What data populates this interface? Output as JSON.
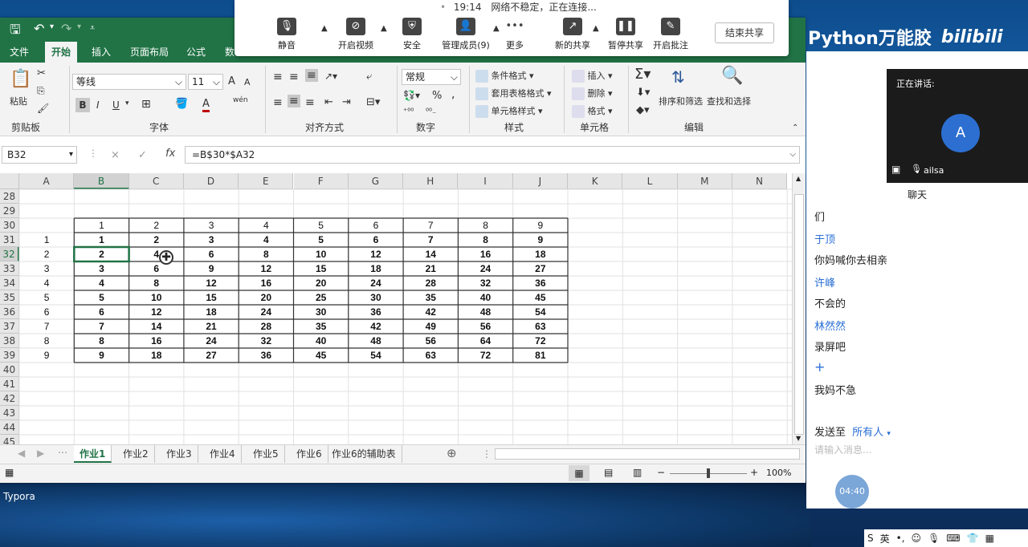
{
  "desktop": {
    "brand_text": "Python万能胶",
    "brand_logo": "bilibili",
    "typora_label": "Typora"
  },
  "excel": {
    "toolbar": {
      "save_icon": "save-icon",
      "undo_icon": "undo-icon",
      "redo_icon": "redo-icon"
    },
    "tabs": [
      "文件",
      "开始",
      "插入",
      "页面布局",
      "公式",
      "数"
    ],
    "active_tab": "开始",
    "ribbon": {
      "clipboard": {
        "paste": "粘贴",
        "label": "剪贴板"
      },
      "font": {
        "name": "等线",
        "size": "11",
        "bold": "B",
        "italic": "I",
        "underline": "U",
        "label": "字体",
        "grow": "A",
        "shrink": "A",
        "font_color": "A",
        "phonetic": "wén"
      },
      "alignment": {
        "label": "对齐方式"
      },
      "number": {
        "format": "常规",
        "percent": "%",
        "comma": ",",
        "label": "数字"
      },
      "styles": {
        "conditional": "条件格式",
        "table": "套用表格格式",
        "cell": "单元格样式",
        "label": "样式"
      },
      "cells": {
        "insert": "插入",
        "delete": "删除",
        "format": "格式",
        "label": "单元格"
      },
      "editing": {
        "sort": "排序和筛选",
        "find": "查找和选择",
        "label": "编辑"
      }
    },
    "formula_bar": {
      "namebox": "B32",
      "cancel": "×",
      "enter": "✓",
      "fx": "fx",
      "formula": "=B$30*$A32"
    },
    "columns": [
      "A",
      "B",
      "C",
      "D",
      "E",
      "F",
      "G",
      "H",
      "I",
      "J",
      "K",
      "L",
      "M",
      "N"
    ],
    "rows": [
      "28",
      "29",
      "30",
      "31",
      "32",
      "33",
      "34",
      "35",
      "36",
      "37",
      "38",
      "39",
      "40",
      "41",
      "42",
      "43",
      "44",
      "45"
    ],
    "header_row": [
      "1",
      "2",
      "3",
      "4",
      "5",
      "6",
      "7",
      "8",
      "9"
    ],
    "table": [
      [
        "1",
        "1",
        "2",
        "3",
        "4",
        "5",
        "6",
        "7",
        "8",
        "9"
      ],
      [
        "2",
        "2",
        "4",
        "6",
        "8",
        "10",
        "12",
        "14",
        "16",
        "18"
      ],
      [
        "3",
        "3",
        "6",
        "9",
        "12",
        "15",
        "18",
        "21",
        "24",
        "27"
      ],
      [
        "4",
        "4",
        "8",
        "12",
        "16",
        "20",
        "24",
        "28",
        "32",
        "36"
      ],
      [
        "5",
        "5",
        "10",
        "15",
        "20",
        "25",
        "30",
        "35",
        "40",
        "45"
      ],
      [
        "6",
        "6",
        "12",
        "18",
        "24",
        "30",
        "36",
        "42",
        "48",
        "54"
      ],
      [
        "7",
        "7",
        "14",
        "21",
        "28",
        "35",
        "42",
        "49",
        "56",
        "63"
      ],
      [
        "8",
        "8",
        "16",
        "24",
        "32",
        "40",
        "48",
        "56",
        "64",
        "72"
      ],
      [
        "9",
        "9",
        "18",
        "27",
        "36",
        "45",
        "54",
        "63",
        "72",
        "81"
      ]
    ],
    "selected_cell": "B32",
    "sheets": [
      "作业1",
      "作业2",
      "作业3",
      "作业4",
      "作业5",
      "作业6",
      "作业6的辅助表"
    ],
    "active_sheet": "作业1",
    "zoom": "100%"
  },
  "meeting": {
    "status_time": "19:14",
    "status_text": "网络不稳定，正在连接...",
    "buttons": [
      {
        "label": "静音",
        "icon": "mic-icon"
      },
      {
        "label": "开启视频",
        "icon": "video-off-icon"
      },
      {
        "label": "安全",
        "icon": "shield-icon"
      },
      {
        "label": "管理成员(9)",
        "icon": "people-icon"
      },
      {
        "label": "更多",
        "icon": "more-icon"
      },
      {
        "label": "新的共享",
        "icon": "share-icon"
      },
      {
        "label": "暂停共享",
        "icon": "pause-icon"
      },
      {
        "label": "开启批注",
        "icon": "annotate-icon"
      }
    ],
    "end_share": "结束共享"
  },
  "right_panel": {
    "speaking_label": "正在讲话:",
    "avatar_letter": "A",
    "user_name": "ailsa",
    "chat_title": "聊天",
    "messages": [
      {
        "name": "",
        "text": "们"
      },
      {
        "name": "于顶",
        "text": "你妈喊你去相亲"
      },
      {
        "name": "许峰",
        "text": "不会的"
      },
      {
        "name": "林然然",
        "text": "录屏吧"
      },
      {
        "name": "+",
        "text": "我妈不急"
      }
    ],
    "send_to_label": "发送至",
    "send_to_target": "所有人",
    "input_placeholder": "请输入消息...",
    "timer": "04:40"
  },
  "tray": {
    "ime": "英"
  }
}
